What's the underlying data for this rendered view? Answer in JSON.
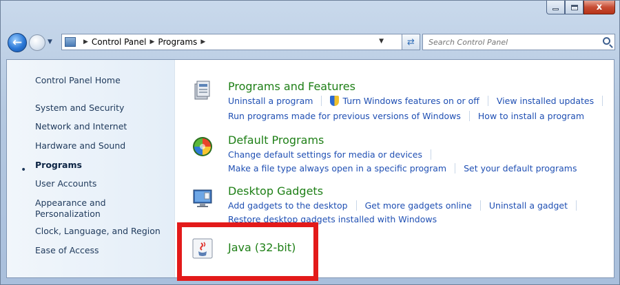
{
  "window": {
    "minimize_icon": "minimize-icon",
    "maximize_icon": "maximize-icon",
    "close_label": "x"
  },
  "address_bar": {
    "breadcrumbs": [
      "Control Panel",
      "Programs"
    ],
    "search_placeholder": "Search Control Panel"
  },
  "sidebar": {
    "items": [
      {
        "label": "Control Panel Home"
      },
      {
        "label": "System and Security"
      },
      {
        "label": "Network and Internet"
      },
      {
        "label": "Hardware and Sound"
      },
      {
        "label": "Programs",
        "active": true
      },
      {
        "label": "User Accounts"
      },
      {
        "label": "Appearance and"
      },
      {
        "label": "Personalization"
      },
      {
        "label": "Clock, Language, and Region"
      },
      {
        "label": "Ease of Access"
      }
    ]
  },
  "categories": {
    "programs_features": {
      "title": "Programs and Features",
      "links_row1": [
        "Uninstall a program",
        "Turn Windows features on or off",
        "View installed updates"
      ],
      "links_row2": [
        "Run programs made for previous versions of Windows",
        "How to install a program"
      ]
    },
    "default_programs": {
      "title": "Default Programs",
      "links_row1": [
        "Change default settings for media or devices"
      ],
      "links_row2": [
        "Make a file type always open in a specific program",
        "Set your default programs"
      ]
    },
    "desktop_gadgets": {
      "title": "Desktop Gadgets",
      "links_row1": [
        "Add gadgets to the desktop",
        "Get more gadgets online",
        "Uninstall a gadget"
      ],
      "links_row2": [
        "Restore desktop gadgets installed with Windows"
      ]
    },
    "java": {
      "title": "Java (32-bit)"
    }
  },
  "colors": {
    "highlight_box": "#e31a1a",
    "category_title": "#1e7f16",
    "link": "#1f4fb3"
  }
}
